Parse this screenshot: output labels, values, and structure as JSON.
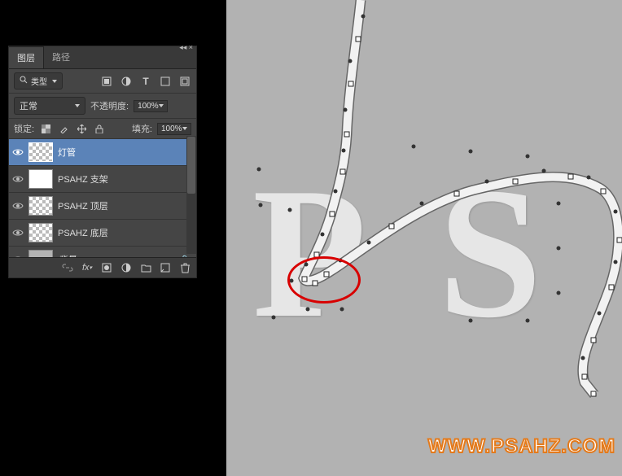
{
  "topTools": {
    "icons": [
      "page-add",
      "camera",
      "trash"
    ]
  },
  "panel": {
    "tabs": {
      "layers": "图层",
      "paths": "路径"
    },
    "activeTab": "layers",
    "filter": {
      "label": "类型"
    },
    "blend": {
      "mode": "正常",
      "opacityLabel": "不透明度:",
      "opacity": "100%"
    },
    "lock": {
      "label": "锁定:",
      "fillLabel": "填充:",
      "fill": "100%"
    },
    "layers": [
      {
        "name": "灯管",
        "visible": true,
        "selected": true,
        "thumb": "trans"
      },
      {
        "name": "PSAHZ 支架",
        "visible": true,
        "selected": false,
        "thumb": "solid"
      },
      {
        "name": "PSAHZ 顶层",
        "visible": true,
        "selected": false,
        "thumb": "trans"
      },
      {
        "name": "PSAHZ 底层",
        "visible": true,
        "selected": false,
        "thumb": "trans"
      },
      {
        "name": "背景",
        "visible": true,
        "selected": false,
        "thumb": "bg",
        "locked": true
      }
    ],
    "footer": {
      "icons": [
        "link",
        "fx",
        "mask",
        "adjust",
        "group",
        "new",
        "trash"
      ]
    }
  },
  "canvas": {
    "text": {
      "p": "P",
      "s": "S"
    },
    "watermark": "WWW.PSAHZ.COM"
  }
}
